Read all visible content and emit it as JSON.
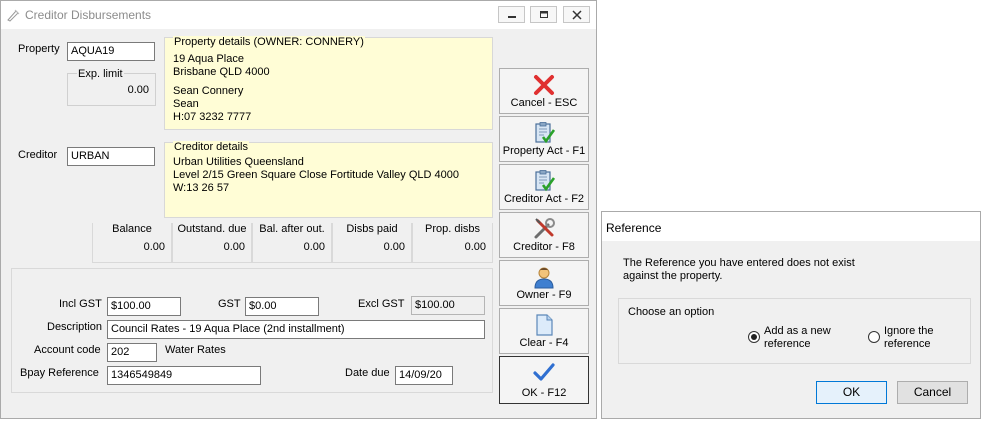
{
  "window": {
    "title": "Creditor Disbursements",
    "controls": [
      "minimize-button",
      "restore-button",
      "close-button"
    ]
  },
  "property": {
    "label": "Property",
    "value": "AQUA19",
    "exp_limit_label": "Exp. limit",
    "exp_limit_value": "0.00",
    "details_title": "Property details  (OWNER:  CONNERY)",
    "details_lines": [
      "19 Aqua Place",
      "Brisbane  QLD  4000",
      "",
      "Sean Connery",
      "Sean",
      "H:07 3232 7777"
    ]
  },
  "creditor": {
    "label": "Creditor",
    "value": "URBAN",
    "details_title": "Creditor details",
    "details_lines": [
      "Urban Utilities Queensland",
      "Level 2/15 Green Square Close Fortitude Valley QLD 4000",
      "W:13 26 57"
    ]
  },
  "summary": [
    {
      "label": "Balance",
      "value": "0.00"
    },
    {
      "label": "Outstand. due",
      "value": "0.00"
    },
    {
      "label": "Bal. after out.",
      "value": "0.00"
    },
    {
      "label": "Disbs paid",
      "value": "0.00"
    },
    {
      "label": "Prop. disbs",
      "value": "0.00"
    }
  ],
  "form": {
    "incl_gst_label": "Incl GST",
    "incl_gst_value": "$100.00",
    "gst_label": "GST",
    "gst_value": "$0.00",
    "excl_gst_label": "Excl GST",
    "excl_gst_value": "$100.00",
    "description_label": "Description",
    "description_value": "Council Rates - 19 Aqua Place (2nd installment)",
    "account_code_label": "Account code",
    "account_code_value": "202",
    "account_name": "Water Rates",
    "bpay_label": "Bpay Reference",
    "bpay_value": "1346549849",
    "date_due_label": "Date due",
    "date_due_value": "14/09/20"
  },
  "side_buttons": [
    {
      "label": "Cancel - ESC",
      "icon": "red-x-icon"
    },
    {
      "label": "Property Act - F1",
      "icon": "clipboard-check-icon"
    },
    {
      "label": "Creditor Act - F2",
      "icon": "clipboard-check-icon"
    },
    {
      "label": "Creditor - F8",
      "icon": "tools-icon"
    },
    {
      "label": "Owner - F9",
      "icon": "person-icon"
    },
    {
      "label": "Clear - F4",
      "icon": "blank-page-icon"
    },
    {
      "label": "OK - F12",
      "icon": "checkmark-icon"
    }
  ],
  "dialog": {
    "title": "Reference",
    "message_line1": "The Reference you have entered does not exist",
    "message_line2": "against the property.",
    "group_title": "Choose an option",
    "option1_line1": "Add as a new",
    "option1_line2": "reference",
    "option2_line1": "Ignore the",
    "option2_line2": "reference",
    "selected_option": "Add as a new reference",
    "ok_label": "OK",
    "cancel_label": "Cancel"
  },
  "colors": {
    "details_bg": "#fffdd6",
    "cancel_icon": "#e03030",
    "ok_check": "#2f6fd1",
    "clipboard_check": "#2aa12a"
  }
}
